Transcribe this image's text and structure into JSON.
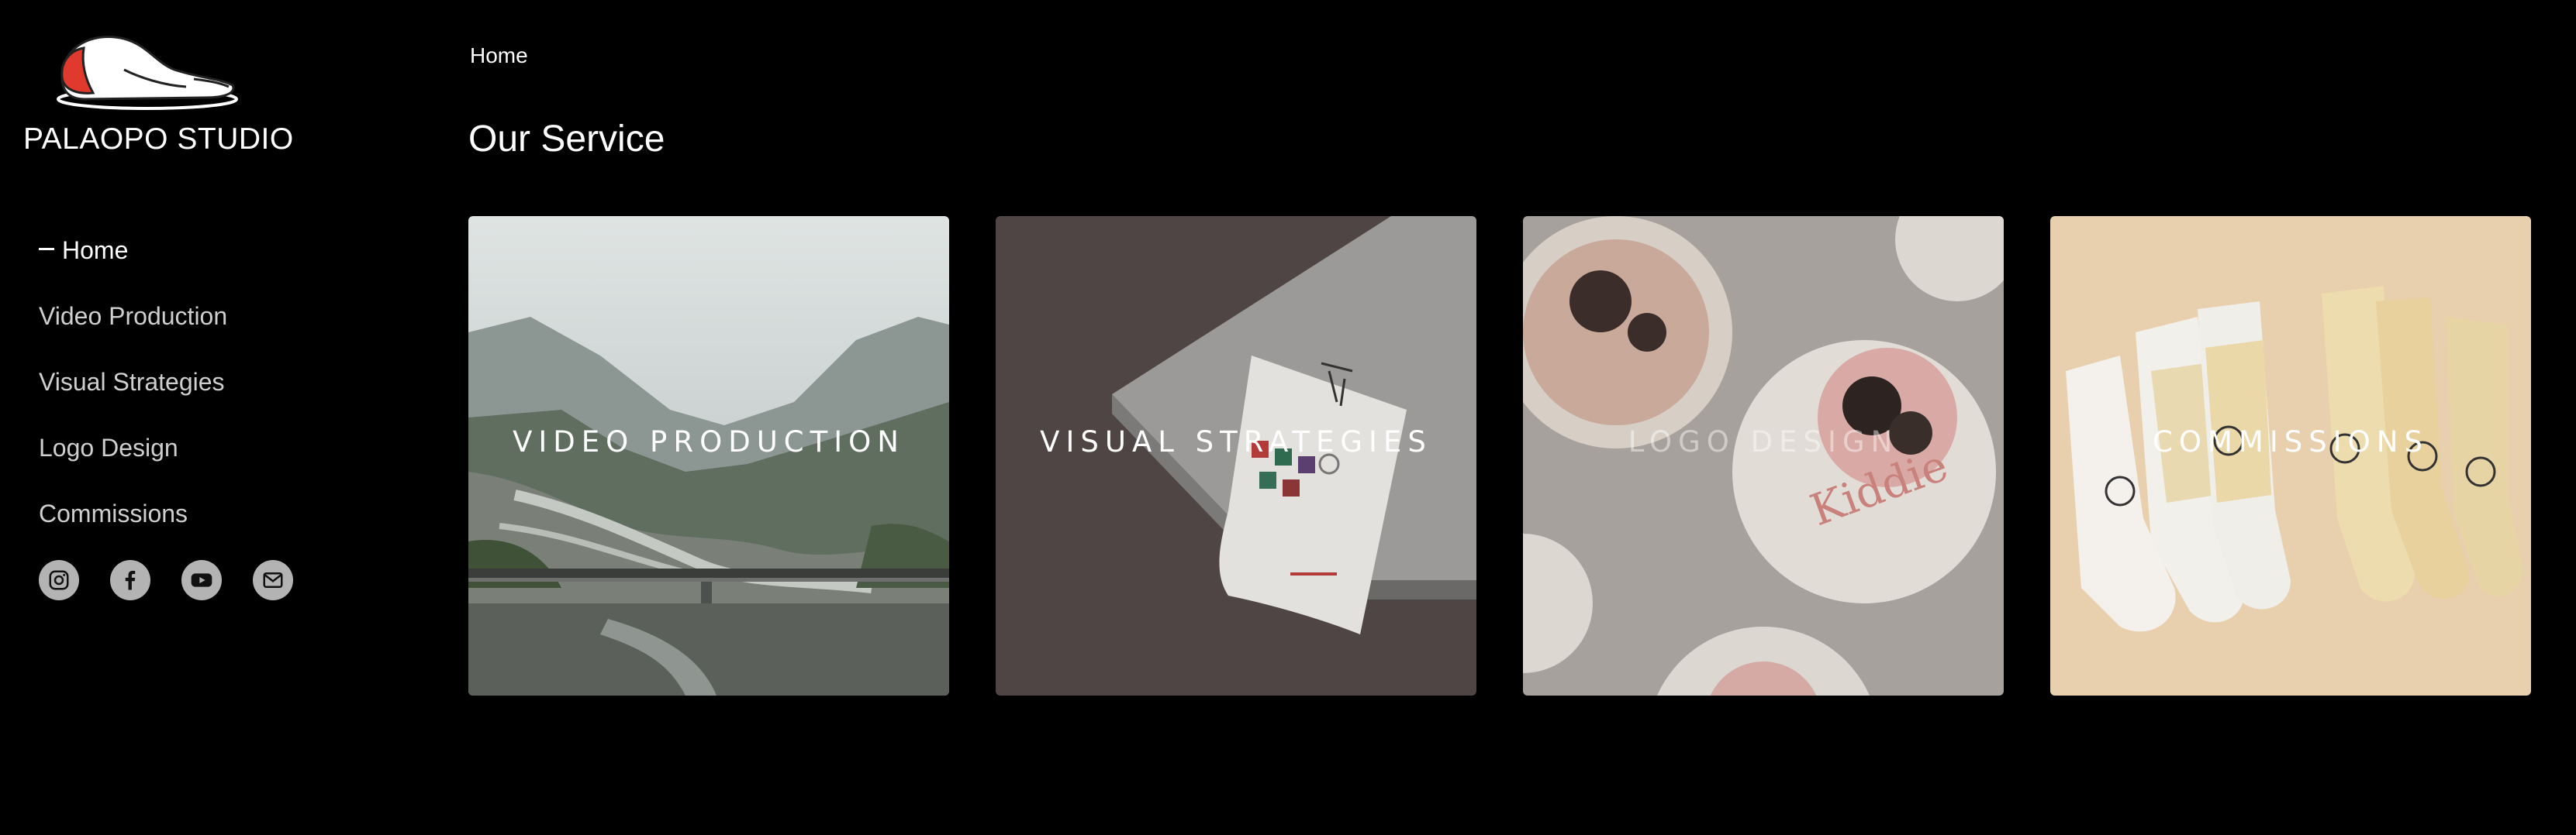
{
  "brand": {
    "name": "PALAOPO STUDIO",
    "logo_icon": "sleeping-figure-logo-icon"
  },
  "nav": {
    "items": [
      {
        "label": "Home",
        "active": true
      },
      {
        "label": "Video Production",
        "active": false
      },
      {
        "label": "Visual Strategies",
        "active": false
      },
      {
        "label": "Logo Design",
        "active": false
      },
      {
        "label": "Commissions",
        "active": false
      }
    ]
  },
  "social": [
    {
      "icon": "instagram-icon"
    },
    {
      "icon": "facebook-icon"
    },
    {
      "icon": "youtube-icon"
    },
    {
      "icon": "email-icon"
    }
  ],
  "breadcrumb": "Home",
  "page_title": "Our Service",
  "cards": [
    {
      "label": "VIDEO PRODUCTION"
    },
    {
      "label": "VISUAL STRATEGIES"
    },
    {
      "label": "LOGO DESIGN"
    },
    {
      "label": "COMMISSIONS"
    }
  ],
  "colors": {
    "background": "#000000",
    "text": "#ffffff",
    "nav_inactive": "#cfcfcf",
    "social_button": "#b3b3b3",
    "logo_accent": "#e03a2e"
  }
}
